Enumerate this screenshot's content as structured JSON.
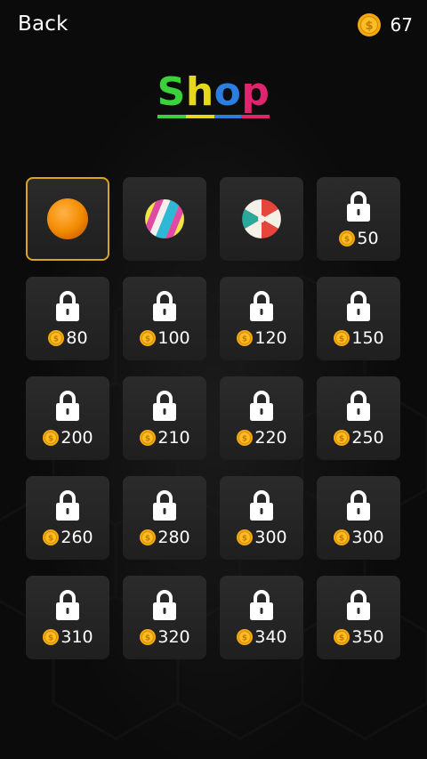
{
  "header": {
    "back_label": "Back",
    "coin_count": "67",
    "coin_icon": "coin-icon"
  },
  "title": {
    "letters": [
      {
        "ch": "S",
        "color": "#3ad13a"
      },
      {
        "ch": "h",
        "color": "#e6d91c"
      },
      {
        "ch": "o",
        "color": "#2b7de0"
      },
      {
        "ch": "p",
        "color": "#e0246e"
      }
    ]
  },
  "items": [
    {
      "state": "selected",
      "icon": "orange-ball-icon"
    },
    {
      "state": "unlocked",
      "icon": "striped-ball-icon"
    },
    {
      "state": "unlocked",
      "icon": "beach-ball-icon"
    },
    {
      "state": "locked",
      "price": "50"
    },
    {
      "state": "locked",
      "price": "80"
    },
    {
      "state": "locked",
      "price": "100"
    },
    {
      "state": "locked",
      "price": "120"
    },
    {
      "state": "locked",
      "price": "150"
    },
    {
      "state": "locked",
      "price": "200"
    },
    {
      "state": "locked",
      "price": "210"
    },
    {
      "state": "locked",
      "price": "220"
    },
    {
      "state": "locked",
      "price": "250"
    },
    {
      "state": "locked",
      "price": "260"
    },
    {
      "state": "locked",
      "price": "280"
    },
    {
      "state": "locked",
      "price": "300"
    },
    {
      "state": "locked",
      "price": "300"
    },
    {
      "state": "locked",
      "price": "310"
    },
    {
      "state": "locked",
      "price": "320"
    },
    {
      "state": "locked",
      "price": "340"
    },
    {
      "state": "locked",
      "price": "350"
    }
  ]
}
